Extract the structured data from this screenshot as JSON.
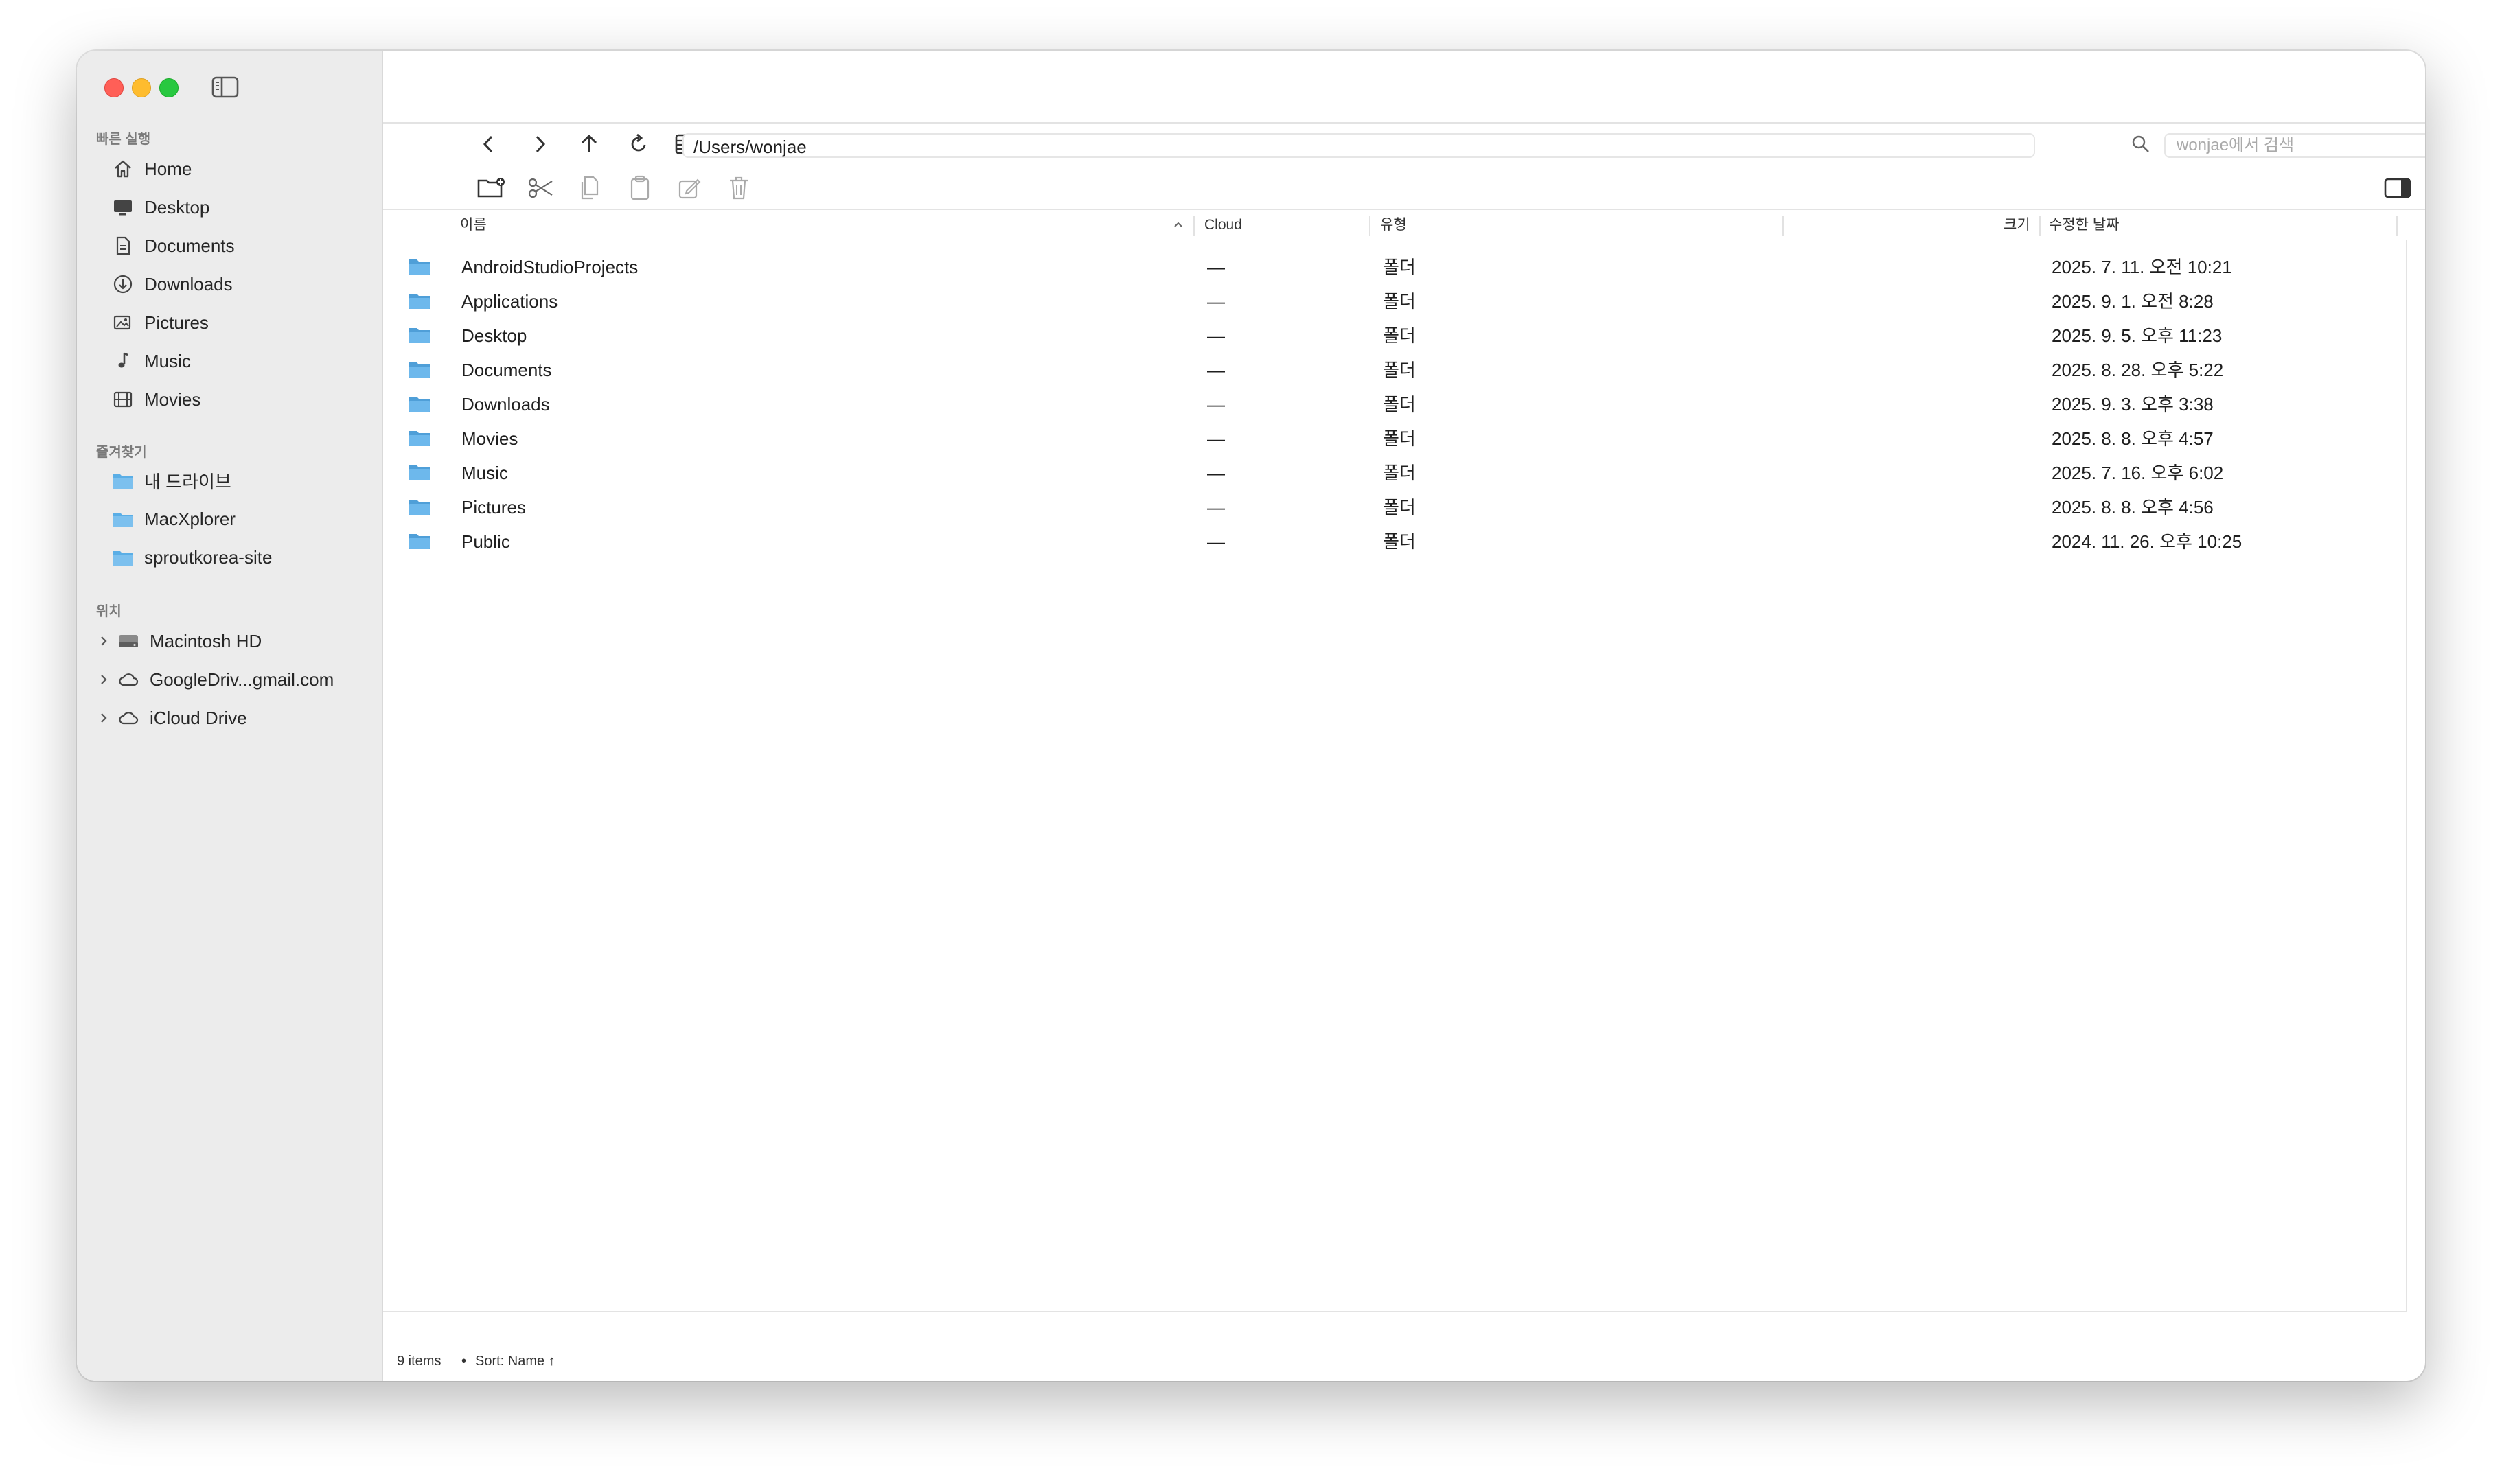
{
  "sidebar": {
    "quick_title": "빠른 실행",
    "quick": [
      {
        "label": "Home",
        "icon": "house-icon"
      },
      {
        "label": "Desktop",
        "icon": "desktop-icon"
      },
      {
        "label": "Documents",
        "icon": "document-icon"
      },
      {
        "label": "Downloads",
        "icon": "download-icon"
      },
      {
        "label": "Pictures",
        "icon": "photo-icon"
      },
      {
        "label": "Music",
        "icon": "music-note-icon"
      },
      {
        "label": "Movies",
        "icon": "film-icon"
      }
    ],
    "fav_title": "즐겨찾기",
    "favorites": [
      {
        "label": "내 드라이브",
        "icon": "folder-icon"
      },
      {
        "label": "MacXplorer",
        "icon": "folder-icon"
      },
      {
        "label": "sproutkorea-site",
        "icon": "folder-icon"
      }
    ],
    "loc_title": "위치",
    "locations": [
      {
        "label": "Macintosh HD",
        "icon": "hard-drive-icon"
      },
      {
        "label": "GoogleDriv...gmail.com",
        "icon": "cloud-icon"
      },
      {
        "label": "iCloud Drive",
        "icon": "cloud-icon"
      }
    ]
  },
  "nav": {
    "path": "/Users/wonjae",
    "search_placeholder": "wonjae에서 검색"
  },
  "columns": {
    "name": "이름",
    "cloud": "Cloud",
    "type": "유형",
    "size": "크기",
    "modified": "수정한 날짜"
  },
  "rows": [
    {
      "name": "AndroidStudioProjects",
      "cloud": "—",
      "type": "폴더",
      "date": "2025. 7. 11. 오전 10:21"
    },
    {
      "name": "Applications",
      "cloud": "—",
      "type": "폴더",
      "date": "2025. 9. 1. 오전 8:28"
    },
    {
      "name": "Desktop",
      "cloud": "—",
      "type": "폴더",
      "date": "2025. 9. 5. 오후 11:23"
    },
    {
      "name": "Documents",
      "cloud": "—",
      "type": "폴더",
      "date": "2025. 8. 28. 오후 5:22"
    },
    {
      "name": "Downloads",
      "cloud": "—",
      "type": "폴더",
      "date": "2025. 9. 3. 오후 3:38"
    },
    {
      "name": "Movies",
      "cloud": "—",
      "type": "폴더",
      "date": "2025. 8. 8. 오후 4:57"
    },
    {
      "name": "Music",
      "cloud": "—",
      "type": "폴더",
      "date": "2025. 7. 16. 오후 6:02"
    },
    {
      "name": "Pictures",
      "cloud": "—",
      "type": "폴더",
      "date": "2025. 8. 8. 오후 4:56"
    },
    {
      "name": "Public",
      "cloud": "—",
      "type": "폴더",
      "date": "2024. 11. 26. 오후 10:25"
    }
  ],
  "status": {
    "count": "9 items",
    "dot": "•",
    "sort": "Sort: Name ↑"
  },
  "colors": {
    "folder": "#5aaee6",
    "sidebar_bg": "#ececec",
    "close": "#ff5f57",
    "minimize": "#febc2e",
    "zoom": "#28c840"
  }
}
